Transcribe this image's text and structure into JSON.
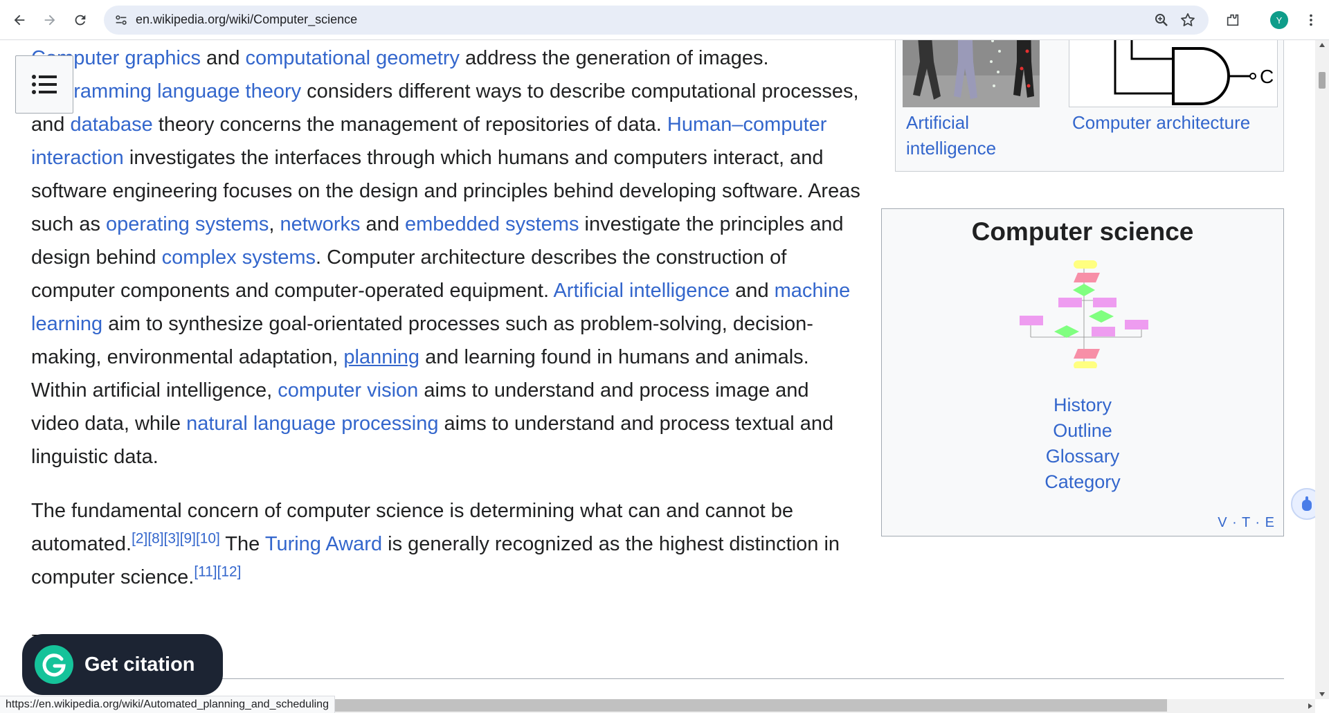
{
  "browser": {
    "url": "en.wikipedia.org/wiki/Computer_science",
    "profile_initial": "Y",
    "status_url": "https://en.wikipedia.org/wiki/Automated_planning_and_scheduling"
  },
  "article": {
    "para1": [
      {
        "t": "Computer graphics",
        "link": true
      },
      {
        "t": " and "
      },
      {
        "t": "computational geometry",
        "link": true
      },
      {
        "t": " address the generation of images. "
      },
      {
        "t": "Programming language theory",
        "link": true
      },
      {
        "t": " considers different ways to describe computational processes, and "
      },
      {
        "t": "database",
        "link": true
      },
      {
        "t": " theory concerns the management of repositories of data. "
      },
      {
        "t": "Human–computer interaction",
        "link": true
      },
      {
        "t": " investigates the interfaces through which humans and computers interact, and software engineering focuses on the design and principles behind developing software. Areas such as "
      },
      {
        "t": "operating systems",
        "link": true
      },
      {
        "t": ", "
      },
      {
        "t": "networks",
        "link": true
      },
      {
        "t": " and "
      },
      {
        "t": "embedded systems",
        "link": true
      },
      {
        "t": " investigate the principles and design behind "
      },
      {
        "t": "complex systems",
        "link": true
      },
      {
        "t": ". Computer architecture describes the construction of computer components and computer-operated equipment. "
      },
      {
        "t": "Artificial intelligence",
        "link": true
      },
      {
        "t": " and "
      },
      {
        "t": "machine learning",
        "link": true
      },
      {
        "t": " aim to synthesize goal-orientated processes such as problem-solving, decision-making, environmental adaptation, "
      },
      {
        "t": "planning",
        "link": true,
        "hover": true
      },
      {
        "t": " and learning found in humans and animals. Within artificial intelligence, "
      },
      {
        "t": "computer vision",
        "link": true
      },
      {
        "t": " aims to understand and process image and video data, while "
      },
      {
        "t": "natural language processing",
        "link": true
      },
      {
        "t": " aims to understand and process textual and linguistic data."
      }
    ],
    "para2": [
      {
        "t": "The fundamental concern of computer science is determining what can and cannot be automated."
      },
      {
        "t": "[2][8][3][9][10]",
        "sup": true
      },
      {
        "t": " The "
      },
      {
        "t": "Turing Award",
        "link": true
      },
      {
        "t": " is generally recognized as the highest distinction in computer science."
      },
      {
        "t": "[11][12]",
        "sup": true
      }
    ],
    "section_heading": "History"
  },
  "gallery": {
    "caption1": "Artificial intelligence",
    "caption2": "Computer architecture",
    "gate_output_label": "C"
  },
  "navbox": {
    "title": "Computer science",
    "links": [
      "History",
      "Outline",
      "Glossary",
      "Category"
    ],
    "vte": "V · T · E"
  },
  "citation": {
    "label": "Get citation"
  },
  "colors": {
    "link": "#3366cc",
    "text": "#202122",
    "citation_bg": "#1c2433",
    "grammarly_green": "#15c39a"
  }
}
